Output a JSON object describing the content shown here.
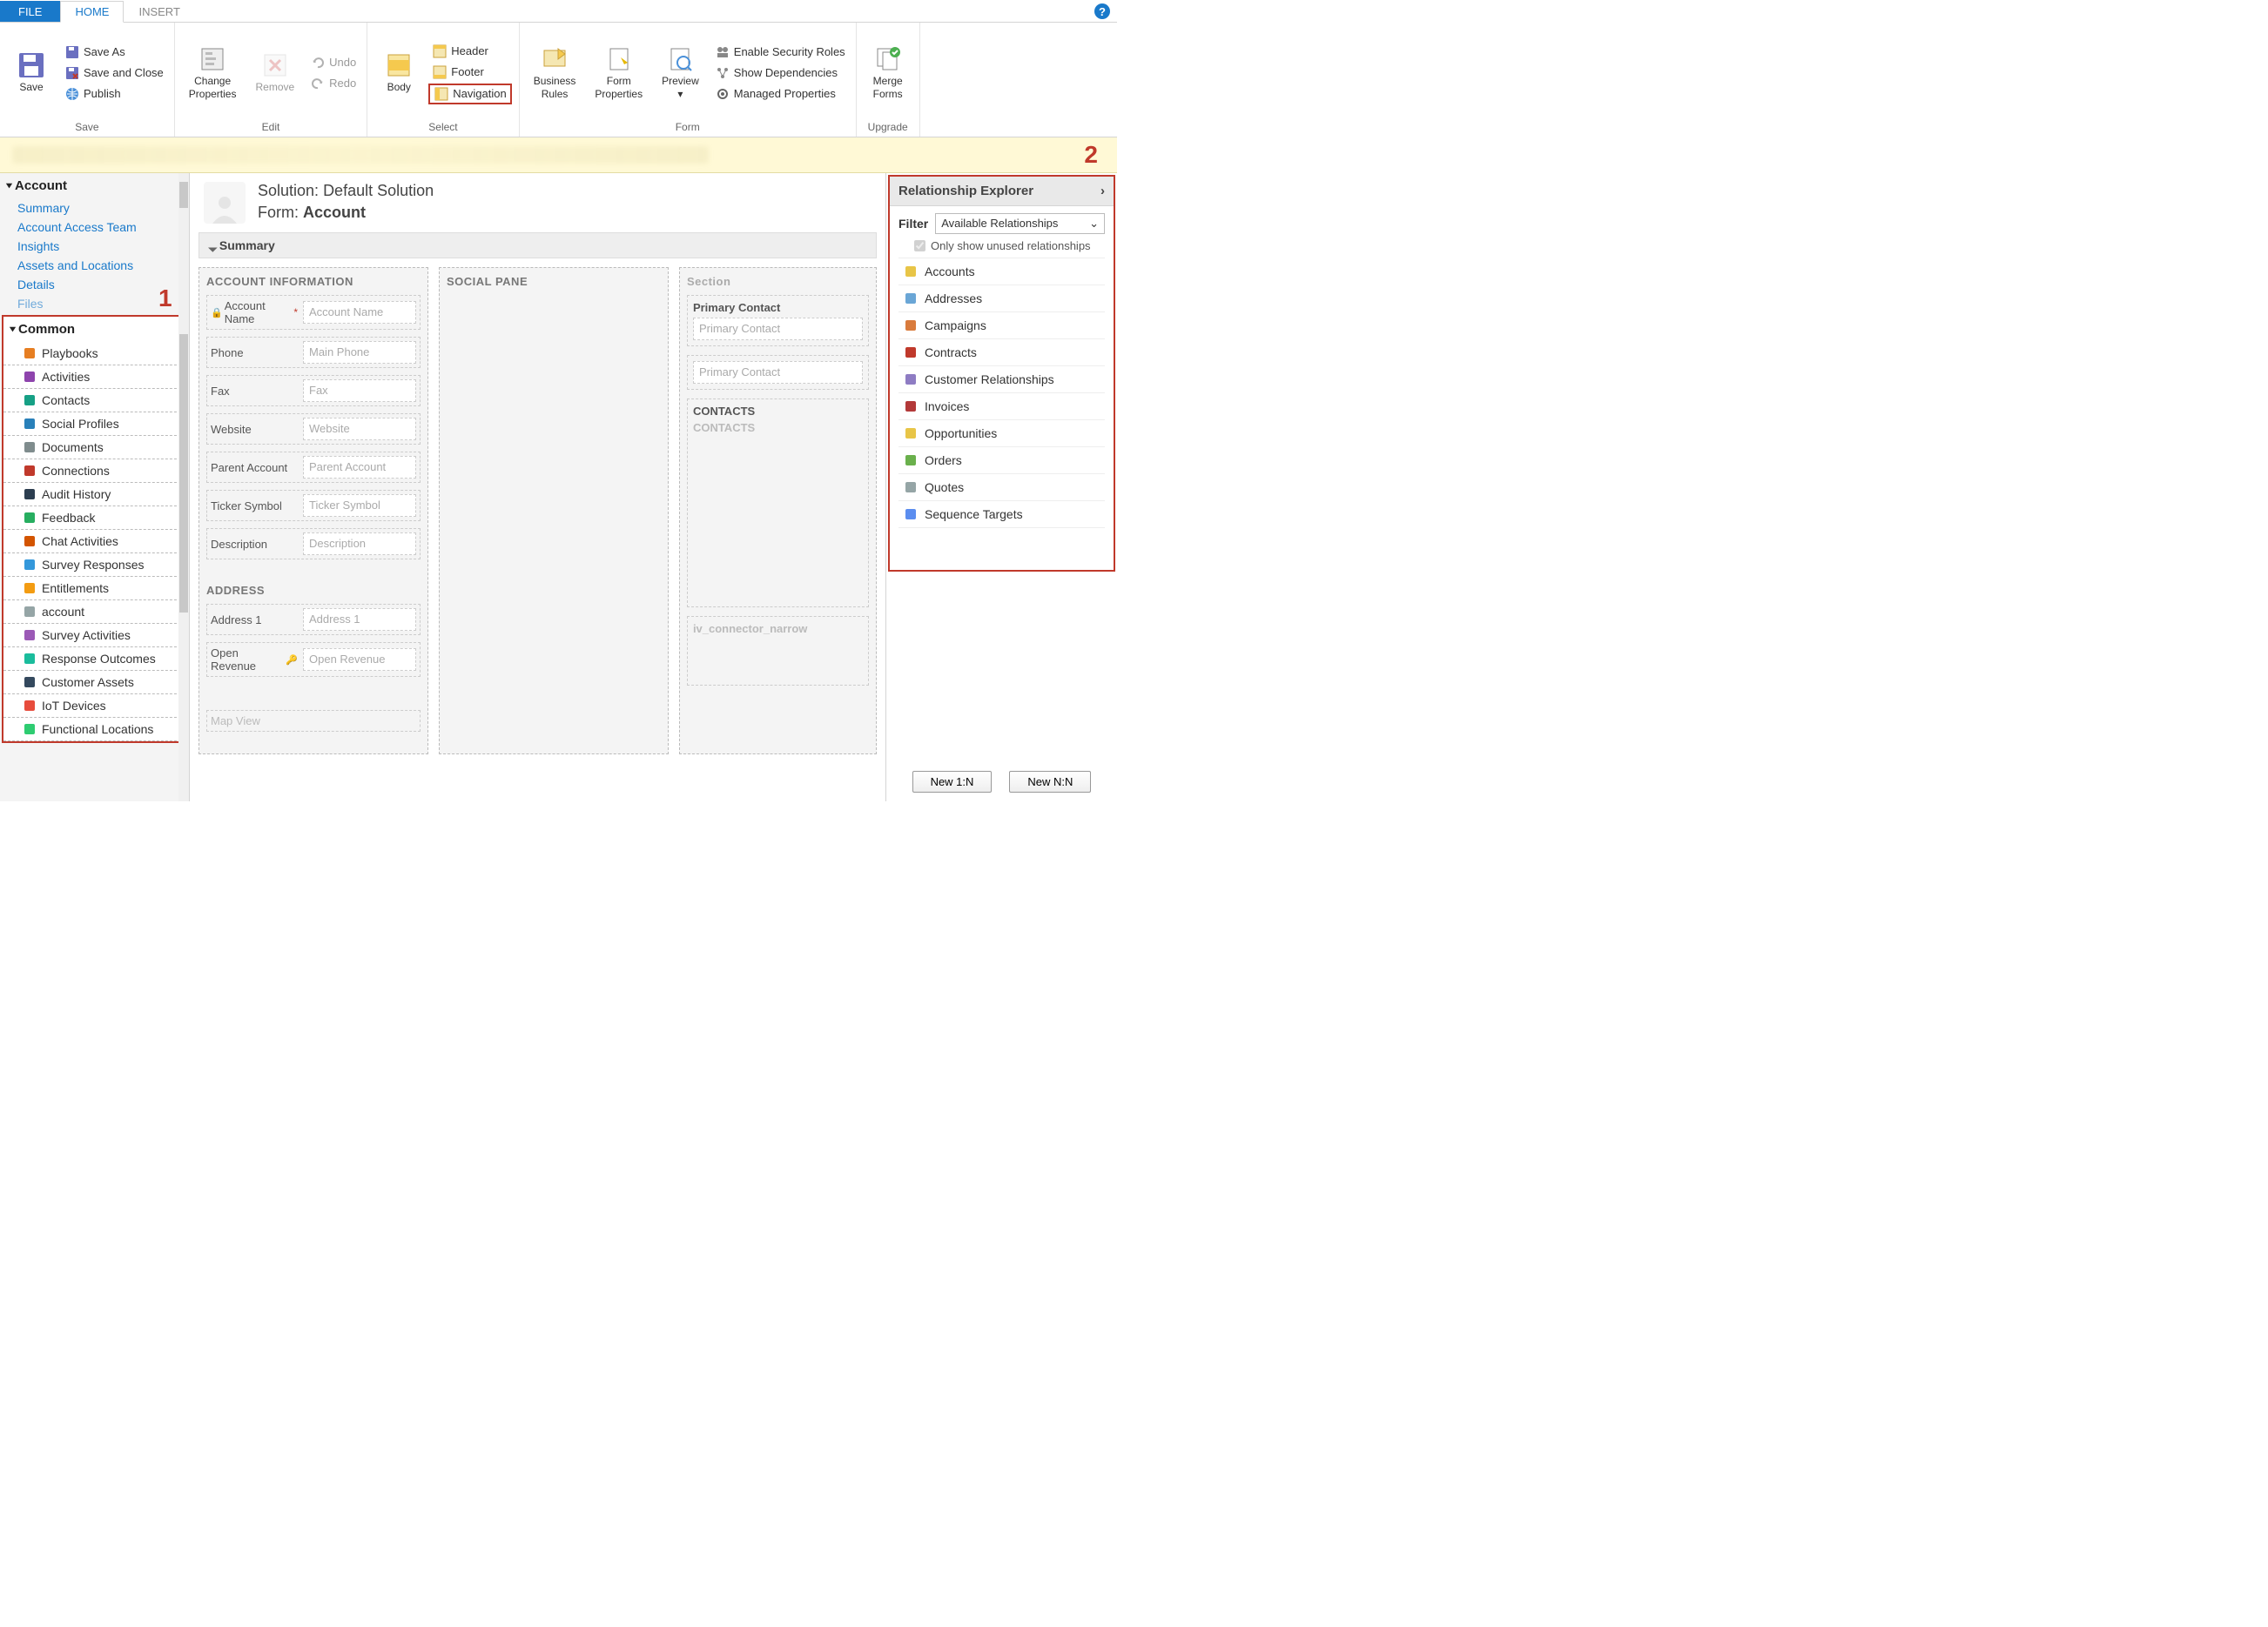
{
  "ribbon": {
    "tabs": {
      "file": "FILE",
      "home": "HOME",
      "insert": "INSERT"
    },
    "save": {
      "save": "Save",
      "save_as": "Save As",
      "save_close": "Save and Close",
      "publish": "Publish",
      "group_label": "Save"
    },
    "edit": {
      "change_properties": "Change\nProperties",
      "remove": "Remove",
      "undo": "Undo",
      "redo": "Redo",
      "group_label": "Edit"
    },
    "select": {
      "body": "Body",
      "header": "Header",
      "footer": "Footer",
      "navigation": "Navigation",
      "group_label": "Select"
    },
    "form": {
      "business_rules": "Business\nRules",
      "form_properties": "Form\nProperties",
      "preview": "Preview",
      "enable_security": "Enable Security Roles",
      "show_deps": "Show Dependencies",
      "managed_props": "Managed Properties",
      "group_label": "Form"
    },
    "upgrade": {
      "merge_forms": "Merge\nForms",
      "group_label": "Upgrade"
    }
  },
  "annotations": {
    "one": "1",
    "two": "2"
  },
  "left_nav": {
    "account_header": "Account",
    "account_links": [
      "Summary",
      "Account Access Team",
      "Insights",
      "Assets and Locations",
      "Details",
      "Files"
    ],
    "common_header": "Common",
    "common_items": [
      "Playbooks",
      "Activities",
      "Contacts",
      "Social Profiles",
      "Documents",
      "Connections",
      "Audit History",
      "Feedback",
      "Chat Activities",
      "Survey Responses",
      "Entitlements",
      "account",
      "Survey Activities",
      "Response Outcomes",
      "Customer Assets",
      "IoT Devices",
      "Functional Locations"
    ]
  },
  "canvas": {
    "solution_prefix": "Solution: ",
    "solution_name": "Default Solution",
    "form_prefix": "Form: ",
    "form_name": "Account",
    "tab_label": "Summary",
    "col1": {
      "section1_title": "ACCOUNT INFORMATION",
      "fields1": [
        {
          "label": "Account Name",
          "placeholder": "Account Name",
          "locked": true,
          "required": true
        },
        {
          "label": "Phone",
          "placeholder": "Main Phone"
        },
        {
          "label": "Fax",
          "placeholder": "Fax"
        },
        {
          "label": "Website",
          "placeholder": "Website"
        },
        {
          "label": "Parent Account",
          "placeholder": "Parent Account"
        },
        {
          "label": "Ticker Symbol",
          "placeholder": "Ticker Symbol"
        },
        {
          "label": "Description",
          "placeholder": "Description"
        }
      ],
      "section2_title": "ADDRESS",
      "fields2": [
        {
          "label": "Address 1",
          "placeholder": "Address 1"
        },
        {
          "label": "Open Revenue",
          "placeholder": "Open Revenue",
          "key": true
        }
      ],
      "map_view": "Map View"
    },
    "col2": {
      "title": "SOCIAL PANE"
    },
    "col3": {
      "title": "Section",
      "primary_contact_label": "Primary Contact",
      "primary_contact_ph": "Primary Contact",
      "primary_contact_ph2": "Primary Contact",
      "contacts_label": "CONTACTS",
      "contacts_ph": "CONTACTS",
      "iv_label": "iv_connector_narrow"
    }
  },
  "right_panel": {
    "title": "Relationship Explorer",
    "filter_label": "Filter",
    "filter_value": "Available Relationships",
    "checkbox_label": "Only show unused relationships",
    "items": [
      "Accounts",
      "Addresses",
      "Campaigns",
      "Contracts",
      "Customer Relationships",
      "Invoices",
      "Opportunities",
      "Orders",
      "Quotes",
      "Sequence Targets"
    ],
    "btn_1n": "New 1:N",
    "btn_nn": "New N:N"
  }
}
